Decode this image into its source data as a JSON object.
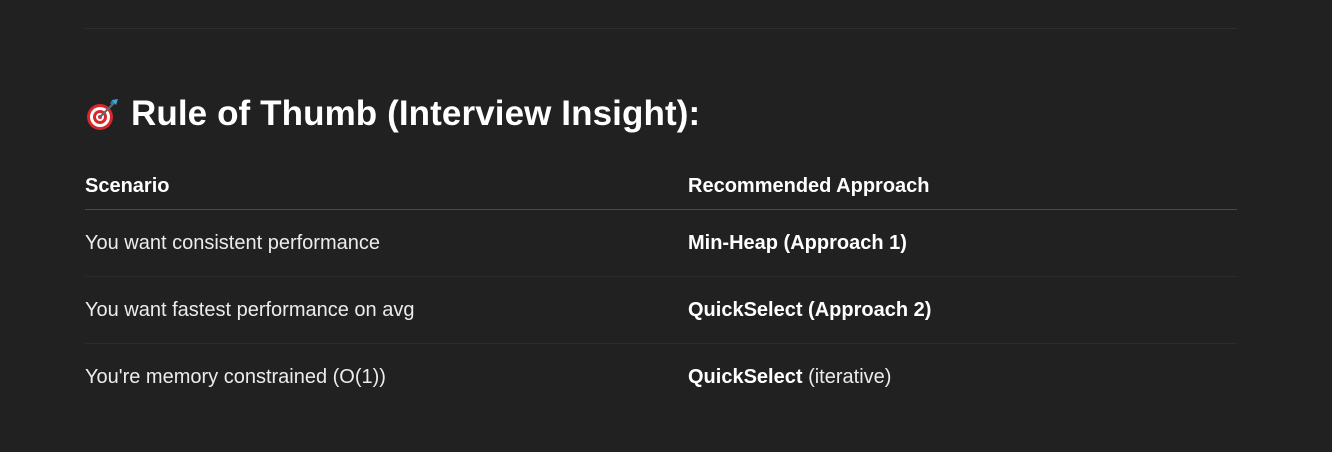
{
  "heading": {
    "icon": "target-dart-icon",
    "text": "Rule of Thumb (Interview Insight):"
  },
  "table": {
    "headers": [
      "Scenario",
      "Recommended Approach"
    ],
    "rows": [
      {
        "scenario": "You want consistent performance",
        "approach_bold": "Min-Heap (Approach 1)",
        "approach_rest": ""
      },
      {
        "scenario": "You want fastest performance on avg",
        "approach_bold": "QuickSelect (Approach 2)",
        "approach_rest": ""
      },
      {
        "scenario": "You're memory constrained (O(1))",
        "approach_bold": "QuickSelect",
        "approach_rest": " (iterative)"
      }
    ]
  },
  "colors": {
    "background": "#212121",
    "text": "#ececec",
    "heading": "#ffffff",
    "divider": "#2e2e2e",
    "target_red": "#d8262a"
  }
}
